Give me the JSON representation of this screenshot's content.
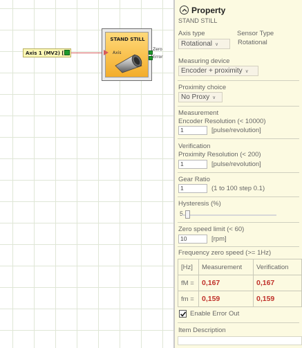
{
  "canvas": {
    "axis_input_label": "Axis 1 (MV2) [0]",
    "block": {
      "title": "STAND STILL",
      "input_pin": "Axis",
      "output_pin_1": "Zero",
      "output_pin_2": "Error"
    }
  },
  "panel": {
    "header_title": "Property",
    "subtitle": "STAND STILL",
    "axis_type": {
      "label": "Axis type",
      "value": "Rotational"
    },
    "sensor_type": {
      "label": "Sensor Type",
      "value": "Rotational"
    },
    "measuring_device": {
      "label": "Measuring device",
      "value": "Encoder + proximity"
    },
    "proximity_choice": {
      "label": "Proximity choice",
      "value": "No Proxy"
    },
    "measurement": {
      "label": "Measurement",
      "sublabel": "Encoder Resolution  (< 10000)",
      "value": "1",
      "unit": "[pulse/revolution]"
    },
    "verification": {
      "label": "Verification",
      "sublabel": "Proximity Resolution  (< 200)",
      "value": "1",
      "unit": "[pulse/revolution]"
    },
    "gear_ratio": {
      "label": "Gear Ratio",
      "value": "1",
      "hint": "(1 to 100 step 0.1)"
    },
    "hysteresis": {
      "label": "Hysteresis (%)",
      "value": "5",
      "level": 5
    },
    "zero_speed": {
      "label": "Zero speed limit  (< 60)",
      "value": "10",
      "unit": "[rpm]"
    },
    "frequency": {
      "label": "Frequency zero speed (>= 1Hz)",
      "headers": [
        "[Hz]",
        "Measurement",
        "Verification"
      ],
      "rows": [
        {
          "label": "fM =",
          "measurement": "0,167",
          "verification": "0,167"
        },
        {
          "label": "fm =",
          "measurement": "0,159",
          "verification": "0,159"
        }
      ]
    },
    "enable_error_out": {
      "label": "Enable Error Out",
      "checked": true
    },
    "item_description": {
      "label": "Item Description",
      "value": ""
    }
  },
  "colors": {
    "panel_bg": "#fcfae1",
    "block_gradient_top": "#ffd97a",
    "block_gradient_bottom": "#f3ad2a",
    "value_red": "#c0322b",
    "port_green": "#1f9a2c",
    "wire_red": "#d65b5b"
  }
}
